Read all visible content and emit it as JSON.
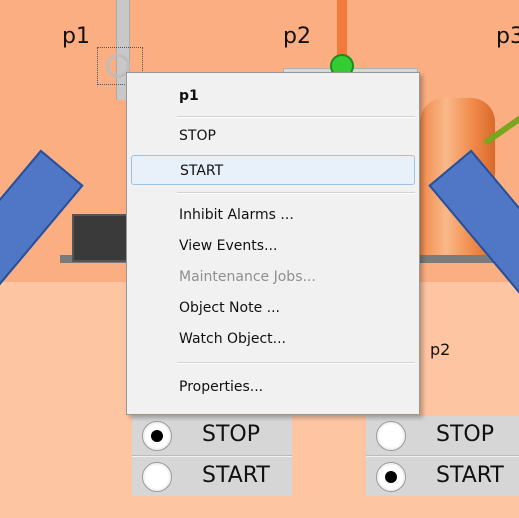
{
  "scada": {
    "tags": {
      "p1": "p1",
      "p2": "p2",
      "p3": "p3",
      "p2_lower": "p2"
    },
    "panels": {
      "left": {
        "stop_label": "STOP",
        "start_label": "START",
        "selected": "STOP"
      },
      "right": {
        "stop_label": "STOP",
        "start_label": "START",
        "selected": "START"
      }
    },
    "colors": {
      "background_upper": "#fcae83",
      "background_lower": "#fdc5a2",
      "arrow": "#4f77c6",
      "indicator_running": "#33cc33",
      "tank": "#f08a4b"
    }
  },
  "context_menu": {
    "title": "p1",
    "items": [
      {
        "label": "STOP",
        "enabled": true
      },
      {
        "label": "START",
        "enabled": true,
        "highlighted": true
      },
      {
        "label": "Inhibit Alarms ...",
        "enabled": true
      },
      {
        "label": "View Events...",
        "enabled": true
      },
      {
        "label": "Maintenance Jobs...",
        "enabled": false
      },
      {
        "label": "Object Note ...",
        "enabled": true
      },
      {
        "label": "Watch Object...",
        "enabled": true
      },
      {
        "label": "Properties...",
        "enabled": true
      }
    ]
  }
}
